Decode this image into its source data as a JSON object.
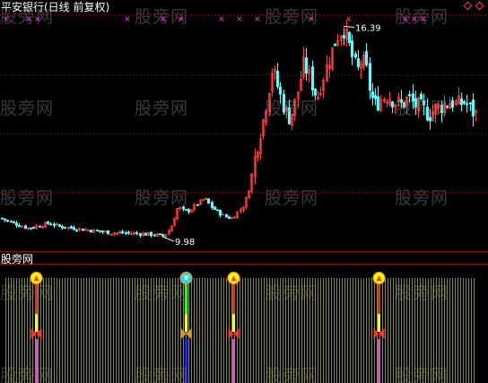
{
  "header": {
    "title": "平安银行(日线 前复权)"
  },
  "subchart": {
    "title": "股旁网"
  },
  "watermark": "股旁网",
  "colors": {
    "background": "#000000",
    "up_candle": "#ff3a3a",
    "down_candle": "#54ffff",
    "grid": "#8b1010",
    "x_marker": "#ff33ff",
    "bar_fill": "#b8b840",
    "signal_yellow": "#ffff00",
    "signal_red": "#ff2020",
    "signal_magenta": "#ff33ff",
    "signal_green": "#22ff22",
    "signal_blue": "#2020ff",
    "signal_cyan": "#22dddd"
  },
  "chart_data": {
    "type": "candlestick",
    "title": "平安银行(日线 前复权)",
    "security": "平安银行",
    "period": "日线",
    "adjustment": "前复权",
    "annotations": [
      {
        "label": "16.39",
        "value": 16.39,
        "kind": "high"
      },
      {
        "label": "9.98",
        "value": 9.98,
        "kind": "low"
      }
    ],
    "ylim": [
      9.6,
      16.7
    ],
    "close_path": [
      [
        0,
        10.55
      ],
      [
        10,
        10.45
      ],
      [
        20,
        10.35
      ],
      [
        30,
        10.25
      ],
      [
        40,
        10.3
      ],
      [
        55,
        10.4
      ],
      [
        65,
        10.3
      ],
      [
        80,
        10.25
      ],
      [
        95,
        10.2
      ],
      [
        110,
        10.15
      ],
      [
        125,
        10.1
      ],
      [
        140,
        10.1
      ],
      [
        155,
        10.08
      ],
      [
        170,
        10.05
      ],
      [
        182,
        10.0
      ],
      [
        190,
        10.25
      ],
      [
        198,
        10.9
      ],
      [
        205,
        10.75
      ],
      [
        212,
        10.8
      ],
      [
        220,
        11.0
      ],
      [
        228,
        11.15
      ],
      [
        235,
        10.9
      ],
      [
        242,
        10.75
      ],
      [
        250,
        10.6
      ],
      [
        258,
        10.55
      ],
      [
        265,
        10.75
      ],
      [
        272,
        10.95
      ],
      [
        278,
        11.5
      ],
      [
        283,
        12.3
      ],
      [
        288,
        13.0
      ],
      [
        293,
        13.5
      ],
      [
        298,
        14.3
      ],
      [
        303,
        15.1
      ],
      [
        308,
        14.7
      ],
      [
        313,
        14.2
      ],
      [
        318,
        13.8
      ],
      [
        323,
        13.6
      ],
      [
        328,
        14.0
      ],
      [
        333,
        14.6
      ],
      [
        338,
        15.2
      ],
      [
        343,
        15.0
      ],
      [
        348,
        14.6
      ],
      [
        353,
        14.2
      ],
      [
        358,
        14.7
      ],
      [
        363,
        15.1
      ],
      [
        368,
        15.5
      ],
      [
        373,
        15.9
      ],
      [
        378,
        16.2
      ],
      [
        383,
        16.3
      ],
      [
        388,
        15.9
      ],
      [
        393,
        15.4
      ],
      [
        398,
        15.0
      ],
      [
        403,
        15.4
      ],
      [
        408,
        15.1
      ],
      [
        413,
        14.3
      ],
      [
        418,
        14.0
      ],
      [
        425,
        14.2
      ],
      [
        432,
        14.3
      ],
      [
        440,
        14.1
      ],
      [
        447,
        14.0
      ],
      [
        455,
        14.2
      ],
      [
        462,
        14.0
      ],
      [
        470,
        13.9
      ],
      [
        478,
        13.7
      ],
      [
        486,
        13.9
      ],
      [
        494,
        14.0
      ],
      [
        502,
        14.1
      ],
      [
        510,
        14.0
      ],
      [
        518,
        14.1
      ],
      [
        526,
        13.8
      ],
      [
        531,
        13.7
      ]
    ],
    "top_x_markers": [
      3,
      28,
      38,
      138,
      178,
      198,
      243,
      263,
      283,
      343,
      385,
      448,
      458,
      468
    ],
    "sub_indicator": {
      "type": "bar",
      "signal_columns": [
        {
          "index": 40,
          "top_icon": "yellow-circle-up-arrow",
          "upper_color": "#ff2020",
          "middle_color": "#ffff00",
          "lower_color": "#ff33ff"
        },
        {
          "index": 207,
          "top_icon": "cyan-circle-down-arrow",
          "upper_color": "#22ff22",
          "middle_color": "#ffff00",
          "lower_color": "#2020ff"
        },
        {
          "index": 260,
          "top_icon": "yellow-circle-up-arrow",
          "upper_color": "#ff2020",
          "middle_color": "#ffff00",
          "lower_color": "#ff33ff"
        },
        {
          "index": 422,
          "top_icon": "yellow-circle-up-arrow",
          "upper_color": "#ff2020",
          "middle_color": "#ffff00",
          "lower_color": "#ff33ff"
        }
      ]
    }
  }
}
